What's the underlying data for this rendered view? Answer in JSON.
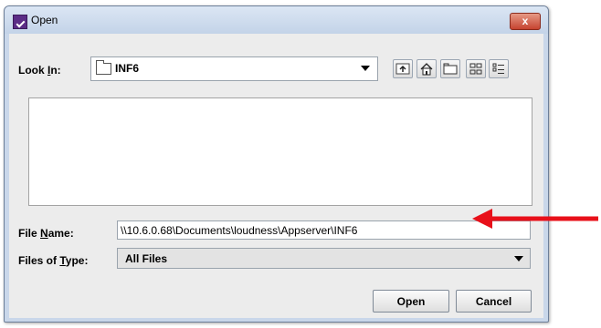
{
  "window": {
    "title": "Open",
    "close_glyph": "x"
  },
  "look_in": {
    "label_pre": "Look ",
    "label_mnemonic": "I",
    "label_post": "n:",
    "value": "INF6",
    "icon": "folder-icon"
  },
  "toolbar": {
    "buttons": [
      {
        "icon": "up-folder-icon"
      },
      {
        "icon": "home-icon"
      },
      {
        "icon": "new-folder-icon"
      },
      {
        "icon": "list-view-icon"
      },
      {
        "icon": "details-view-icon"
      }
    ]
  },
  "file_name": {
    "label_pre": "File ",
    "label_mnemonic": "N",
    "label_post": "ame:",
    "value": "\\\\10.6.0.68\\Documents\\loudness\\Appserver\\INF6"
  },
  "files_of_type": {
    "label_pre": "Files of ",
    "label_mnemonic": "T",
    "label_post": "ype:",
    "value": "All Files"
  },
  "buttons": {
    "open": "Open",
    "cancel": "Cancel"
  },
  "annotation": {
    "arrow_color": "#e8101a"
  }
}
